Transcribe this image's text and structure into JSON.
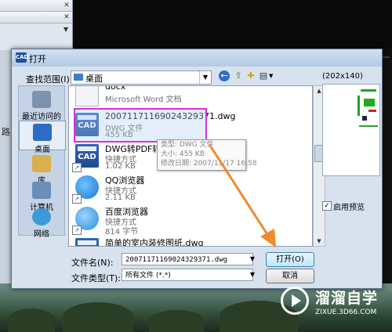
{
  "dialog": {
    "title": "打开",
    "title_icon": "CAD",
    "look_in_label": "查找范围(I):",
    "look_in_value": "桌面",
    "preview_size": "(202x140)",
    "enable_preview_label": "启用预览",
    "enable_preview_checked": true
  },
  "places": [
    {
      "label": "最近访问的位置",
      "icon": "recent-places-icon"
    },
    {
      "label": "桌面",
      "icon": "desktop-icon",
      "selected": true
    },
    {
      "label": "库",
      "icon": "libraries-icon"
    },
    {
      "label": "计算机",
      "icon": "computer-icon"
    },
    {
      "label": "网络",
      "icon": "network-icon"
    }
  ],
  "files": [
    {
      "name": "docx",
      "type": "Microsoft Word 文档",
      "size": ""
    },
    {
      "name": "20071171169024329371.dwg",
      "type": "DWG 文件",
      "size": "455 KB"
    },
    {
      "name": "DWG转PDF转换器",
      "type": "快捷方式",
      "size": "1.02 KB"
    },
    {
      "name": "QQ浏览器",
      "type": "快捷方式",
      "size": "2.11 KB"
    },
    {
      "name": "百度浏览器",
      "type": "快捷方式",
      "size": "814 字节"
    },
    {
      "name": "简单的室内装修图纸.dwg",
      "type": "",
      "size": ""
    }
  ],
  "file_icon_label": "CAD",
  "tooltip": {
    "line1": "类型: DWG 文件",
    "line2": "大小: 455 KB",
    "line3": "修改日期: 2007/11/17 16:58"
  },
  "fields": {
    "filename_label": "文件名(N):",
    "filename_value": "20071171169024329371.dwg",
    "filetype_label": "文件类型(T):",
    "filetype_value": "所有文件 (*.*)"
  },
  "buttons": {
    "open": "打开(O)",
    "cancel": "取消"
  },
  "background": {
    "side_label": "路"
  },
  "watermark": {
    "brand": "溜溜自学",
    "url": "ZIXUE.3D66.COM"
  }
}
